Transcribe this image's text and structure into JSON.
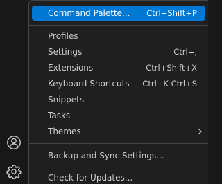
{
  "menu": {
    "top_peek": "—",
    "items": [
      {
        "label": "Command Palette...",
        "keybinding": "Ctrl+Shift+P"
      },
      {
        "label": "Profiles",
        "keybinding": ""
      },
      {
        "label": "Settings",
        "keybinding": "Ctrl+,"
      },
      {
        "label": "Extensions",
        "keybinding": "Ctrl+Shift+X"
      },
      {
        "label": "Keyboard Shortcuts",
        "keybinding": "Ctrl+K Ctrl+S"
      },
      {
        "label": "Snippets",
        "keybinding": ""
      },
      {
        "label": "Tasks",
        "keybinding": ""
      },
      {
        "label": "Themes",
        "keybinding": ""
      },
      {
        "label": "Backup and Sync Settings...",
        "keybinding": ""
      },
      {
        "label": "Check for Updates...",
        "keybinding": ""
      }
    ]
  },
  "activity_bar": {
    "icons": [
      "accounts-icon",
      "gear-icon"
    ]
  },
  "colors": {
    "highlight": "#0078d4",
    "menu_background": "#1f1f1f",
    "activity_background": "#181818",
    "separator": "#454545",
    "text": "#cccccc"
  }
}
